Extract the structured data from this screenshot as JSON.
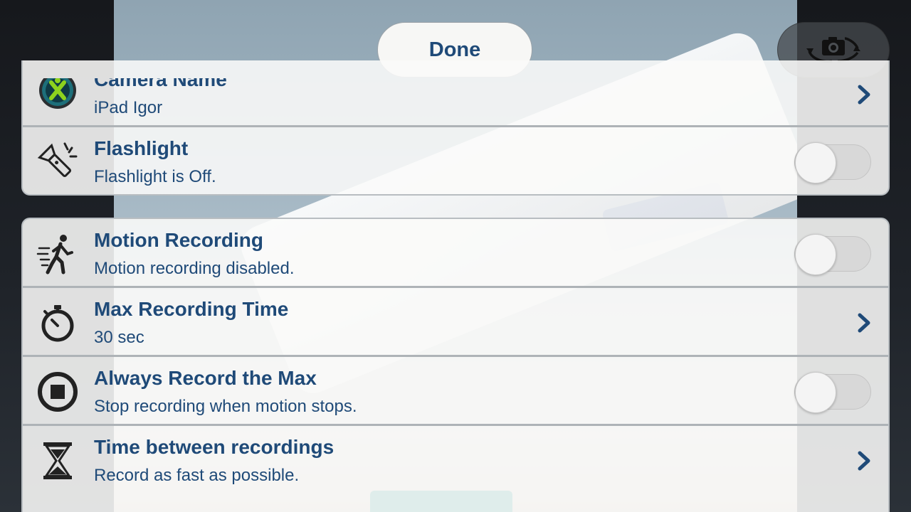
{
  "header": {
    "done_label": "Done",
    "switch_camera_icon": "camera-switch-icon"
  },
  "group1": {
    "rows": [
      {
        "title": "Camera Name",
        "subtitle": "iPad Igor",
        "icon": "camera-app-icon",
        "control": "chevron"
      },
      {
        "title": "Flashlight",
        "subtitle": "Flashlight is Off.",
        "icon": "flashlight-icon",
        "control": "toggle",
        "on": false
      }
    ]
  },
  "group2": {
    "rows": [
      {
        "title": "Motion Recording",
        "subtitle": "Motion recording disabled.",
        "icon": "running-person-icon",
        "control": "toggle",
        "on": false
      },
      {
        "title": "Max Recording Time",
        "subtitle": "30 sec",
        "icon": "stopwatch-icon",
        "control": "chevron"
      },
      {
        "title": "Always Record the Max",
        "subtitle": "Stop recording when motion stops.",
        "icon": "stop-circle-icon",
        "control": "toggle",
        "on": false
      },
      {
        "title": "Time between recordings",
        "subtitle": "Record as fast as possible.",
        "icon": "hourglass-icon",
        "control": "chevron"
      }
    ]
  },
  "colors": {
    "accent": "#1f4a78",
    "row_background": "#fafaf9",
    "toggle_off": "#d8d8d8"
  }
}
